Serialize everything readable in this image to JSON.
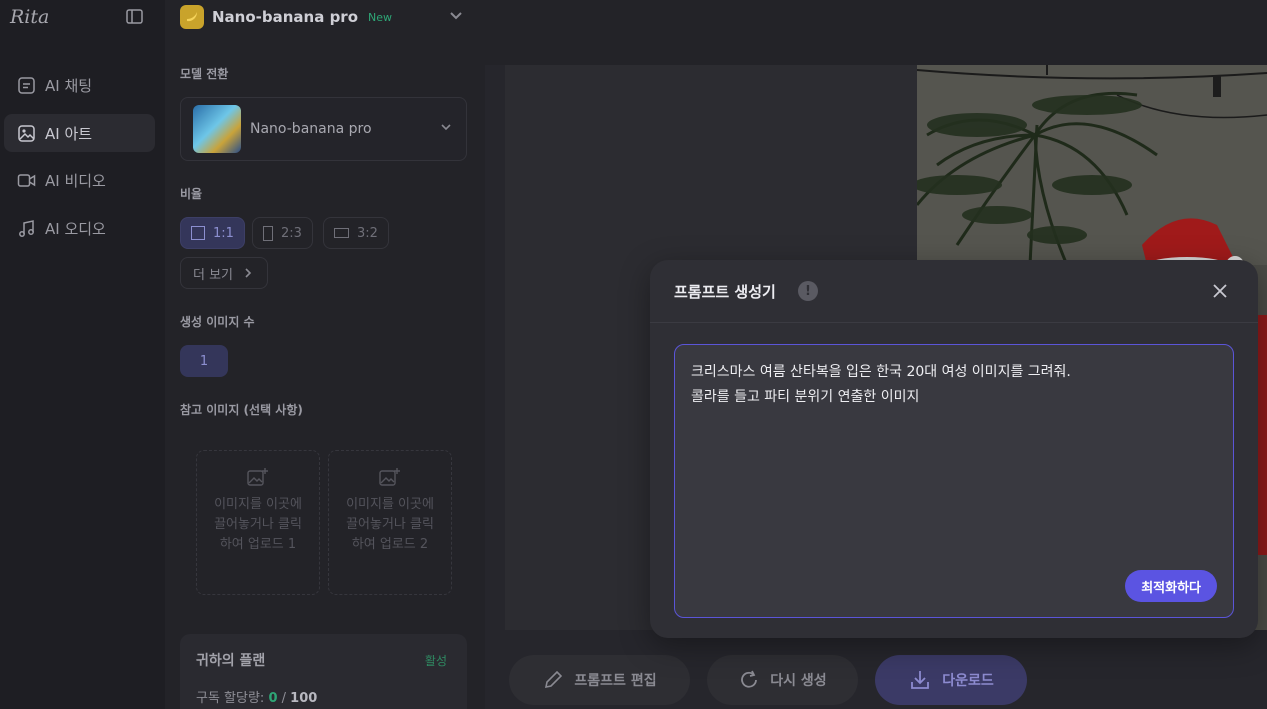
{
  "app": {
    "logo": "Rita"
  },
  "sidebar": {
    "items": [
      {
        "label": "AI 채팅",
        "icon": "chat-icon"
      },
      {
        "label": "AI 아트",
        "icon": "image-icon",
        "active": true
      },
      {
        "label": "AI 비디오",
        "icon": "video-icon"
      },
      {
        "label": "AI 오디오",
        "icon": "music-icon"
      }
    ]
  },
  "header": {
    "model_name": "Nano-banana pro",
    "badge": "New"
  },
  "settings": {
    "model_label": "모델 전환",
    "model_selected": "Nano-banana pro",
    "ratio_label": "비율",
    "ratios": [
      "1:1",
      "2:3",
      "3:2"
    ],
    "ratio_selected": "1:1",
    "more": "더 보기",
    "count_label": "생성 이미지 수",
    "count_value": "1",
    "ref_label": "참고 이미지 (선택 사항)",
    "upload1": "이미지를 이곳에 끌어놓거나 클릭하여 업로드 1",
    "upload2": "이미지를 이곳에 끌어놓거나 클릭하여 업로드 2"
  },
  "plan": {
    "title": "귀하의 플랜",
    "status": "활성",
    "quota_label": "구독 할당량:",
    "quota_used": "0",
    "quota_sep": "/",
    "quota_total": "100"
  },
  "actions": {
    "edit": "프롬프트 편집",
    "regenerate": "다시 생성",
    "download": "다운로드"
  },
  "modal": {
    "title": "프롬프트 생성기",
    "info": "!",
    "prompt_line1": "크리스마스 여름 산타복을 입은 한국 20대 여성 이미지를 그려줘.",
    "prompt_line2": "콜라를 들고 파티 분위기 연출한 이미지",
    "optimize": "최적화하다"
  },
  "colors": {
    "accent": "#5b54e2",
    "success": "#2ea676"
  }
}
